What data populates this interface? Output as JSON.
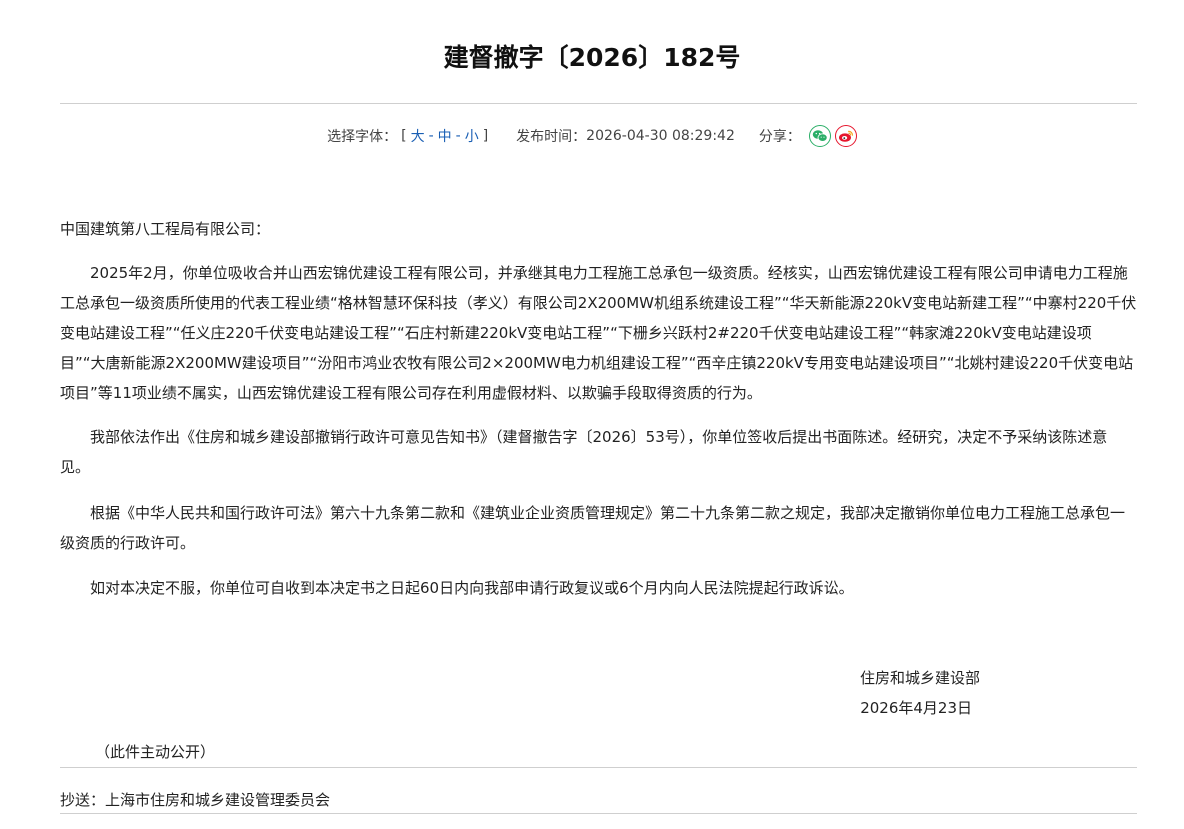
{
  "doc": {
    "title": "建督撤字〔2026〕182号"
  },
  "meta": {
    "font_label": "选择字体：",
    "bracket_open": "[",
    "bracket_close": "]",
    "font_large": "大",
    "font_medium": "中",
    "font_small": "小",
    "separator": "-",
    "publish_label": "发布时间：",
    "publish_time": "2026-04-30 08:29:42",
    "share_label": "分享：",
    "share_icons": [
      "wechat-icon",
      "weibo-icon"
    ],
    "colors": {
      "link": "#1a5fb4",
      "wechat": "#2aae67",
      "weibo": "#e6162d"
    }
  },
  "body": {
    "salutation": "中国建筑第八工程局有限公司：",
    "paragraphs": [
      "2025年2月，你单位吸收合并山西宏锦优建设工程有限公司，并承继其电力工程施工总承包一级资质。经核实，山西宏锦优建设工程有限公司申请电力工程施工总承包一级资质所使用的代表工程业绩“格林智慧环保科技（孝义）有限公司2X200MW机组系统建设工程”“华天新能源220kV变电站新建工程”“中寨村220千伏变电站建设工程”“任义庄220千伏变电站建设工程”“石庄村新建220kV变电站工程”“下栅乡兴跃村2#220千伏变电站建设工程”“韩家滩220kV变电站建设项目”“大唐新能源2X200MW建设项目”“汾阳市鸿业农牧有限公司2×200MW电力机组建设工程”“西辛庄镇220kV专用变电站建设项目”“北姚村建设220千伏变电站项目”等11项业绩不属实，山西宏锦优建设工程有限公司存在利用虚假材料、以欺骗手段取得资质的行为。",
      "我部依法作出《住房和城乡建设部撤销行政许可意见告知书》（建督撤告字〔2026〕53号），你单位签收后提出书面陈述。经研究，决定不予采纳该陈述意见。",
      "根据《中华人民共和国行政许可法》第六十九条第二款和《建筑业企业资质管理规定》第二十九条第二款之规定，我部决定撤销你单位电力工程施工总承包一级资质的行政许可。",
      "如对本决定不服，你单位可自收到本决定书之日起60日内向我部申请行政复议或6个月内向人民法院提起行政诉讼。"
    ]
  },
  "signature": {
    "org": "住房和城乡建设部",
    "date": "2026年4月23日"
  },
  "public_note": "（此件主动公开）",
  "cc": "抄送：上海市住房和城乡建设管理委员会"
}
